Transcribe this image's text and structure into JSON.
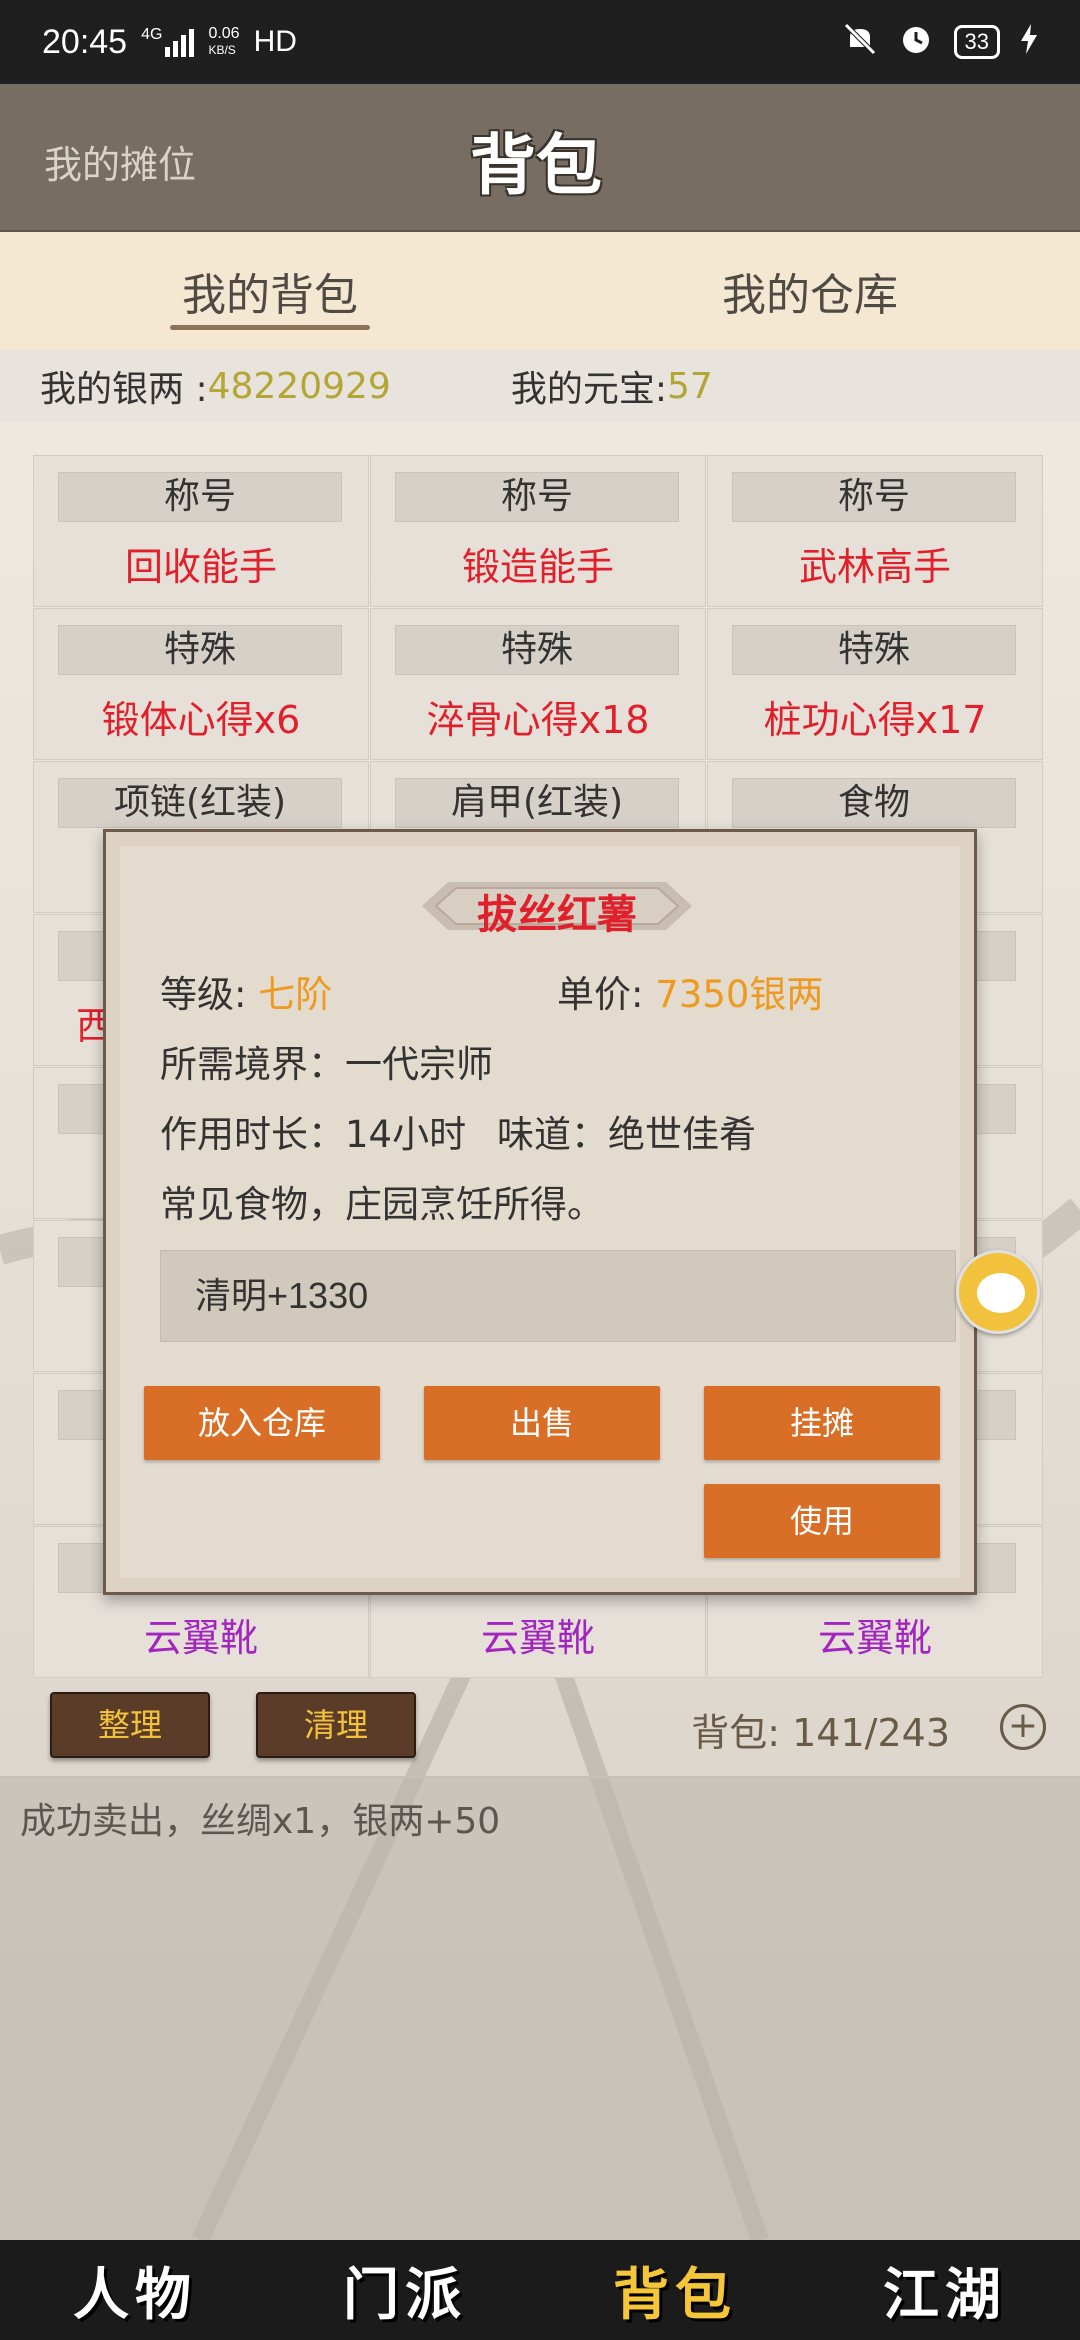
{
  "statusbar": {
    "time": "20:45",
    "network": "4G",
    "speed_top": "0.06",
    "speed_bottom": "KB/S",
    "hd": "HD",
    "battery": "33"
  },
  "header": {
    "stall_label": "我的摊位",
    "title": "背包"
  },
  "tabs": [
    {
      "label": "我的背包",
      "active": true
    },
    {
      "label": "我的仓库",
      "active": false
    }
  ],
  "money": {
    "silver_label": "我的银两 : ",
    "silver_value": "48220929",
    "gold_label": "我的元宝: ",
    "gold_value": "57"
  },
  "grid": {
    "cells": [
      {
        "category": "称号",
        "name": "回收能手",
        "color": "red"
      },
      {
        "category": "称号",
        "name": "锻造能手",
        "color": "red"
      },
      {
        "category": "称号",
        "name": "武林高手",
        "color": "red"
      },
      {
        "category": "特殊",
        "name": "锻体心得x6",
        "color": "red"
      },
      {
        "category": "特殊",
        "name": "淬骨心得x18",
        "color": "red"
      },
      {
        "category": "特殊",
        "name": "桩功心得x17",
        "color": "red"
      },
      {
        "category": "项链(红装)",
        "name": "",
        "color": "red"
      },
      {
        "category": "肩甲(红装)",
        "name": "",
        "color": "red"
      },
      {
        "category": "食物",
        "name": "",
        "color": "red"
      },
      {
        "category": "",
        "name": "西",
        "color": "red"
      },
      {
        "category": "",
        "name": "",
        "color": "red"
      },
      {
        "category": "",
        "name": "",
        "color": "red"
      },
      {
        "category": "",
        "name": "",
        "color": "red"
      },
      {
        "category": "",
        "name": "",
        "color": "red"
      },
      {
        "category": "",
        "name": "",
        "color": "red"
      },
      {
        "category": "",
        "name": "",
        "color": "red"
      },
      {
        "category": "",
        "name": "",
        "color": "red"
      },
      {
        "category": "",
        "name": "",
        "color": "red"
      },
      {
        "category": "",
        "name": "",
        "color": "red"
      },
      {
        "category": "",
        "name": "",
        "color": "red"
      },
      {
        "category": "",
        "name": "",
        "color": "red"
      },
      {
        "category": "",
        "name": "云翼靴",
        "color": "purple"
      },
      {
        "category": "",
        "name": "云翼靴",
        "color": "purple"
      },
      {
        "category": "",
        "name": "云翼靴",
        "color": "purple"
      }
    ]
  },
  "controls": {
    "sort_label": "整理",
    "clean_label": "清理",
    "bag_count": "背包: 141/243",
    "plus": "+"
  },
  "message": "成功卖出，丝绸x1，银两+50",
  "popup": {
    "title": "拔丝红薯",
    "level_label": "等级:",
    "level_value": "七阶",
    "price_label": "单价:",
    "price_value": "7350银两",
    "realm": "所需境界：一代宗师",
    "duration": "作用时长：14小时",
    "taste": "味道：绝世佳肴",
    "desc": "常见食物，庄园烹饪所得。",
    "effect": "清明+1330",
    "btn_store": "放入仓库",
    "btn_sell": "出售",
    "btn_stall": "挂摊",
    "btn_use": "使用"
  },
  "nav": [
    {
      "label": "人物",
      "active": false
    },
    {
      "label": "门派",
      "active": false
    },
    {
      "label": "背包",
      "active": true
    },
    {
      "label": "江湖",
      "active": false
    }
  ],
  "colors": {
    "accent_orange": "#d96f27",
    "red_text": "#e0202a",
    "purple_text": "#a225c0",
    "gold_value": "#b3a634",
    "nav_active": "#f6c63a"
  }
}
